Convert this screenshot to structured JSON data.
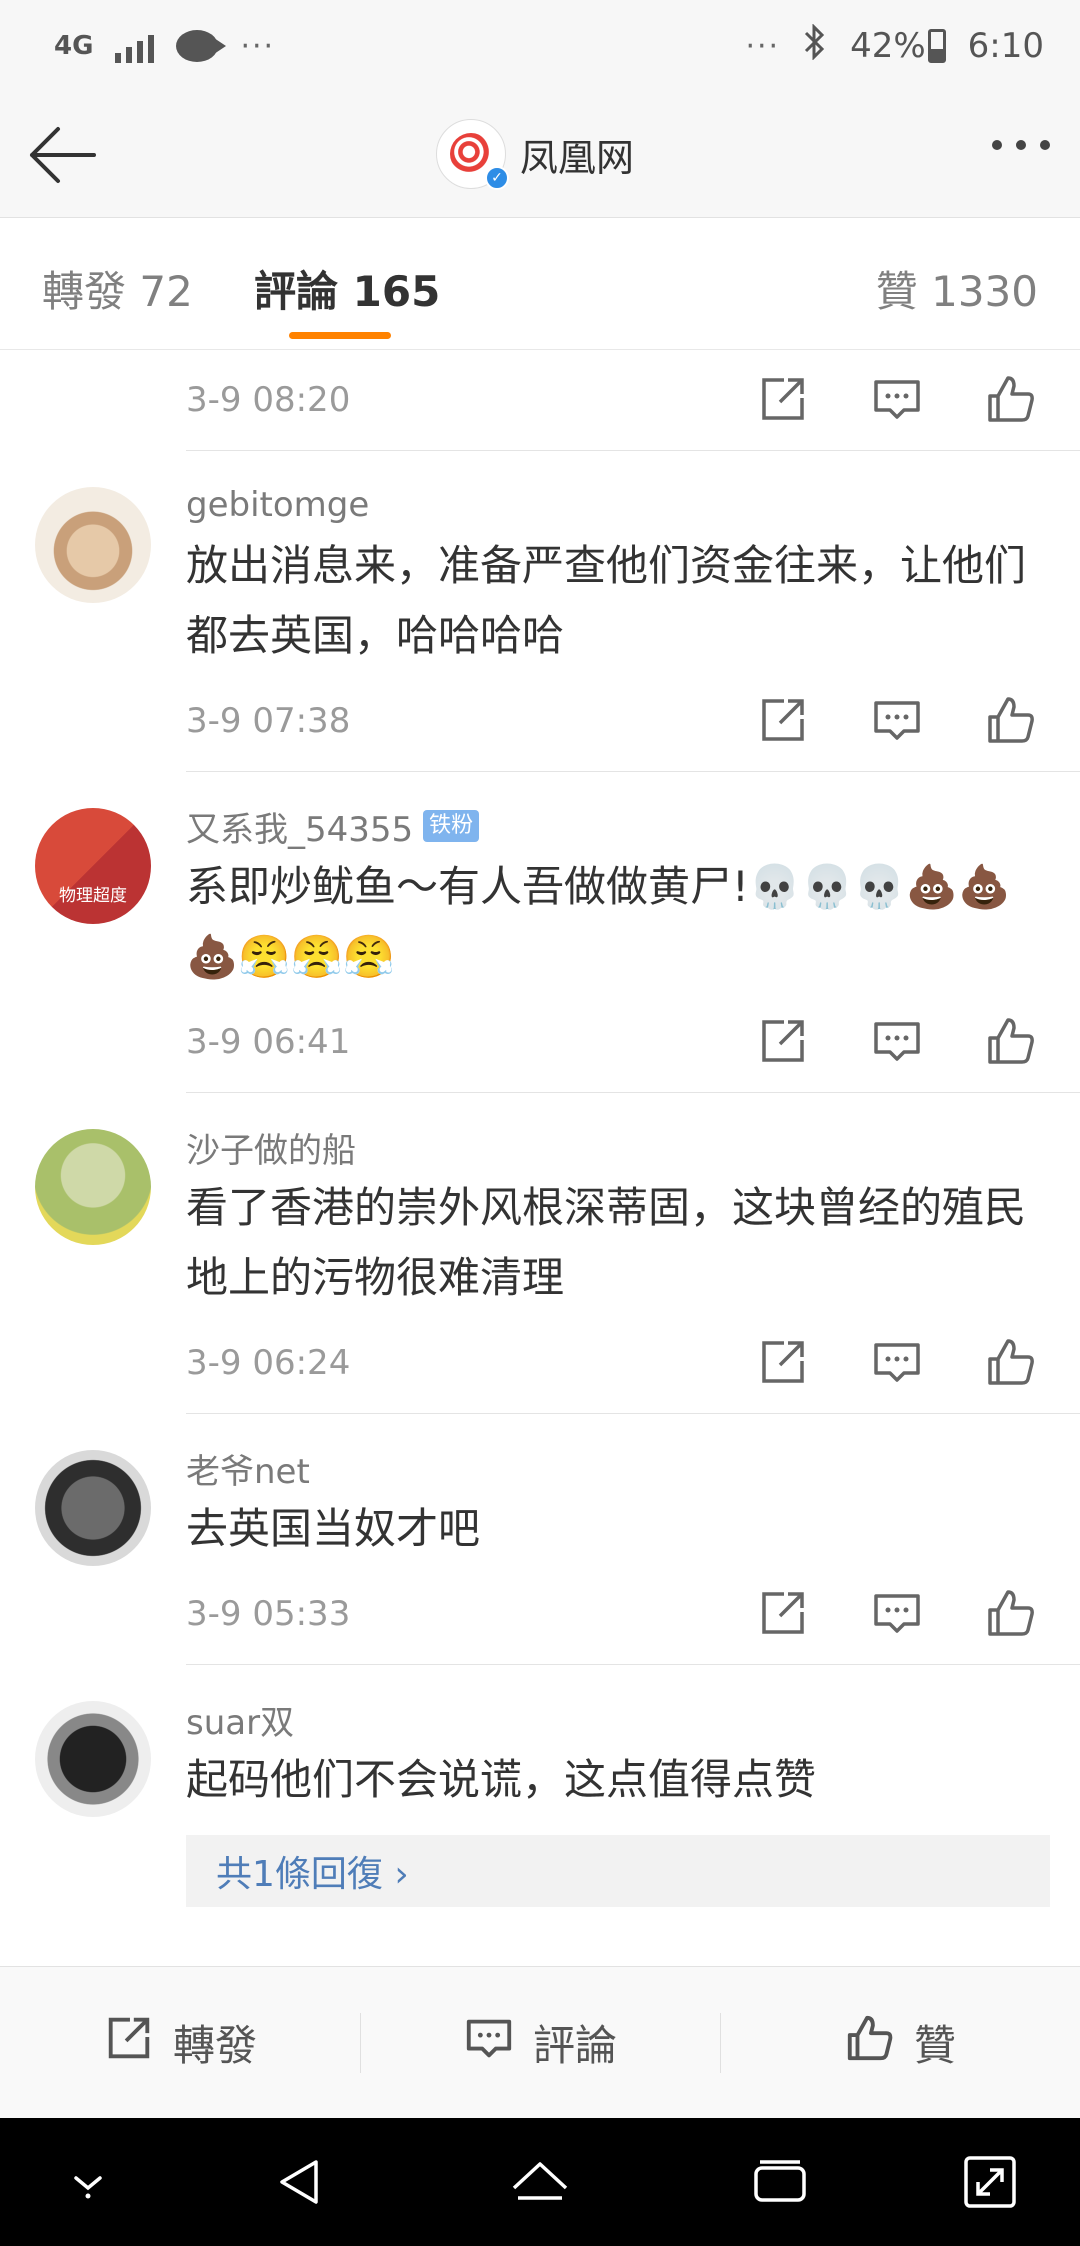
{
  "status_bar": {
    "network": "4G",
    "overflow": "···",
    "right_overflow": "···",
    "battery": "42%",
    "time": "6:10"
  },
  "nav": {
    "title": "凤凰网"
  },
  "tabs": {
    "repost": "轉發 72",
    "comment": "評論 165",
    "like": "贊 1330",
    "active": "comment",
    "accent": "#ff8200"
  },
  "comments": [
    {
      "time": "3-9 08:20"
    },
    {
      "username": "gebitomge",
      "text": "放出消息来，准备严查他们资金往来，让他们都去英国，哈哈哈哈",
      "time": "3-9 07:38"
    },
    {
      "username": "又系我_54355",
      "badge": "铁粉",
      "avatar_label": "物理超度",
      "text": "系即炒鱿鱼～有人吾做做黄尸!💀💀💀💩💩💩😤😤😤",
      "time": "3-9 06:41"
    },
    {
      "username": "沙子做的船",
      "text": "看了香港的崇外风根深蒂固，这块曾经的殖民地上的污物很难清理",
      "time": "3-9 06:24"
    },
    {
      "username": "老爷net",
      "text": "去英国当奴才吧",
      "time": "3-9 05:33"
    },
    {
      "username": "suar双",
      "text": "起码他们不会说谎，这点值得点赞",
      "reply_link": "共1條回復 ›"
    }
  ],
  "bottom_bar": {
    "repost": "轉發",
    "comment": "評論",
    "like": "贊"
  },
  "icons": [
    "back-arrow-icon",
    "more-icon",
    "share-icon",
    "comment-icon",
    "like-icon",
    "home-icon",
    "back-icon",
    "recents-icon",
    "expand-icon",
    "down-icon"
  ]
}
